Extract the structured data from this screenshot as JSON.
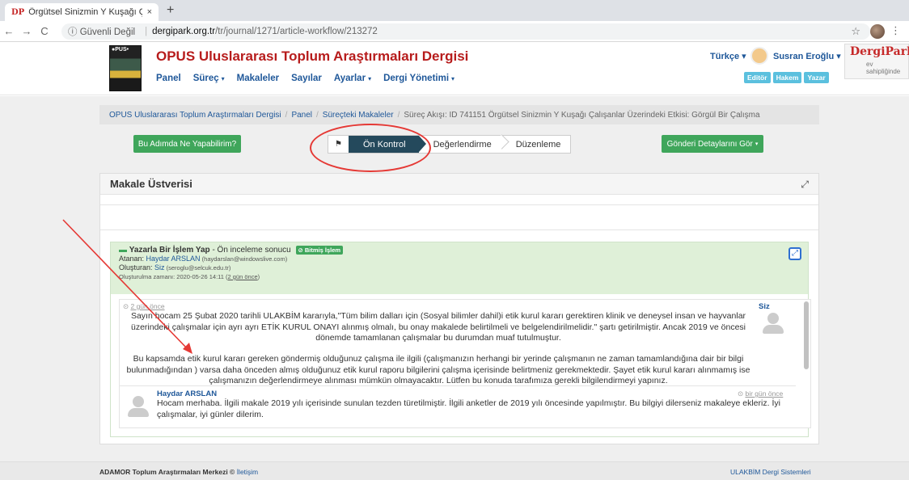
{
  "browser": {
    "tab_favicon": "DP",
    "tab_title": "Örgütsel Sinizmin Y Kuşağı Çalış",
    "tab_close": "×",
    "new_tab": "+",
    "security_label": "ⓘ Güvenli Değil",
    "url_separator": "|",
    "url_host": "dergipark.org.tr",
    "url_path": "/tr/journal/1271/article-workflow/213272"
  },
  "header": {
    "cover_text": "●PUS•",
    "journal_title": "OPUS Uluslararası Toplum Araştırmaları Dergisi",
    "nav": [
      {
        "label": "Panel",
        "dropdown": false
      },
      {
        "label": "Süreç",
        "dropdown": true
      },
      {
        "label": "Makaleler",
        "dropdown": false
      },
      {
        "label": "Sayılar",
        "dropdown": false
      },
      {
        "label": "Ayarlar",
        "dropdown": true
      },
      {
        "label": "Dergi Yönetimi",
        "dropdown": true
      }
    ],
    "language": "Türkçe ▾",
    "user_name": "Susran Eroğlu ▾",
    "roles": [
      "Editör",
      "Hakem",
      "Yazar"
    ],
    "brand_name": "DergiPark",
    "brand_sub": "ev sahipliğinde"
  },
  "breadcrumb": [
    "OPUS Uluslararası Toplum Araştırmaları Dergisi",
    "Panel",
    "Süreçteki Makaleler"
  ],
  "breadcrumb_active": "Süreç Akışı: ID 741151 Örgütsel Sinizmin Y Kuşağı Çalışanlar Üzerindeki Etkisi: Görgül Bir Çalışma",
  "actions": {
    "help_button": "Bu Adımda Ne Yapabilirim?",
    "details_button": "Gönderi Detaylarını Gör"
  },
  "workflow_steps": {
    "flag": "⚑",
    "active": "Ön Kontrol",
    "review": "Değerlendirme",
    "edit": "Düzenleme"
  },
  "panel": {
    "title": "Makale Üstverisi"
  },
  "task": {
    "title": "Yazarla Bir İşlem Yap",
    "title_suffix": " - Ön inceleme sonucu",
    "badge": "⊘ Bitmiş İşlem",
    "assignee_label": "Atanan: ",
    "assignee_name": "Haydar ARSLAN",
    "assignee_email": " (haydarslan@windowslive.com)",
    "creator_label": "Oluşturan: ",
    "creator_name": "Siz",
    "creator_email": " (seroglu@selcuk.edu.tr)",
    "created_label": "Oluşturulma zamanı: 2020-05-26 14:11 (",
    "created_rel": "2 gün önce",
    "created_end": ")"
  },
  "messages": [
    {
      "when": "2 gün önce",
      "author": "Siz",
      "text1": "Sayın hocam 25 Şubat 2020 tarihli ULAKBİM kararıyla,\"Tüm bilim dalları için (Sosyal bilimler dahil)i etik kurul kararı gerektiren klinik ve deneysel insan ve hayvanlar üzerindeki çalışmalar için ayrı ayrı ETİK KURUL ONAYI alınmış olmalı, bu onay makalede belirtilmeli ve belgelendirilmelidir.\" şartı getirilmiştir. Ancak 2019 ve öncesi dönemde tamamlanan çalışmalar bu durumdan muaf tutulmuştur.",
      "text2": "Bu kapsamda etik kurul kararı gereken göndermiş olduğunuz çalışma ile ilgili (çalışmanızın herhangi bir yerinde çalışmanın ne zaman tamamlandığına dair bir bilgi bulunmadığından ) varsa daha önceden almış olduğunuz etik kurul raporu bilgilerini çalışma içerisinde belirtmeniz gerekmektedir. Şayet etik kurul kararı alınmamış ise çalışmanızın değerlendirmeye alınması mümkün olmayacaktır. Lütfen bu konuda tarafımıza gerekli bilgilendirmeyi yapınız."
    },
    {
      "when": "bir gün önce",
      "author": "Haydar ARSLAN",
      "text": "Hocam merhaba. İlgili makale 2019 yılı içerisinde sunulan tezden türetilmiştir. İlgili anketler de 2019 yılı öncesinde yapılmıştır. Bu bilgiyi dilerseniz makaleye ekleriz. İyi çalışmalar, iyi günler dilerim."
    }
  ],
  "footer": {
    "org": "ADAMOR Toplum Araştırmaları Merkezi © ",
    "contact": "İletişim",
    "system": "ULAKBİM Dergi Sistemleri"
  },
  "colors": {
    "journal_red": "#b71c1c",
    "link_blue": "#1e5799",
    "green_button": "#3fa65b",
    "step_active": "#24495c",
    "annotation_red": "#e53935"
  }
}
